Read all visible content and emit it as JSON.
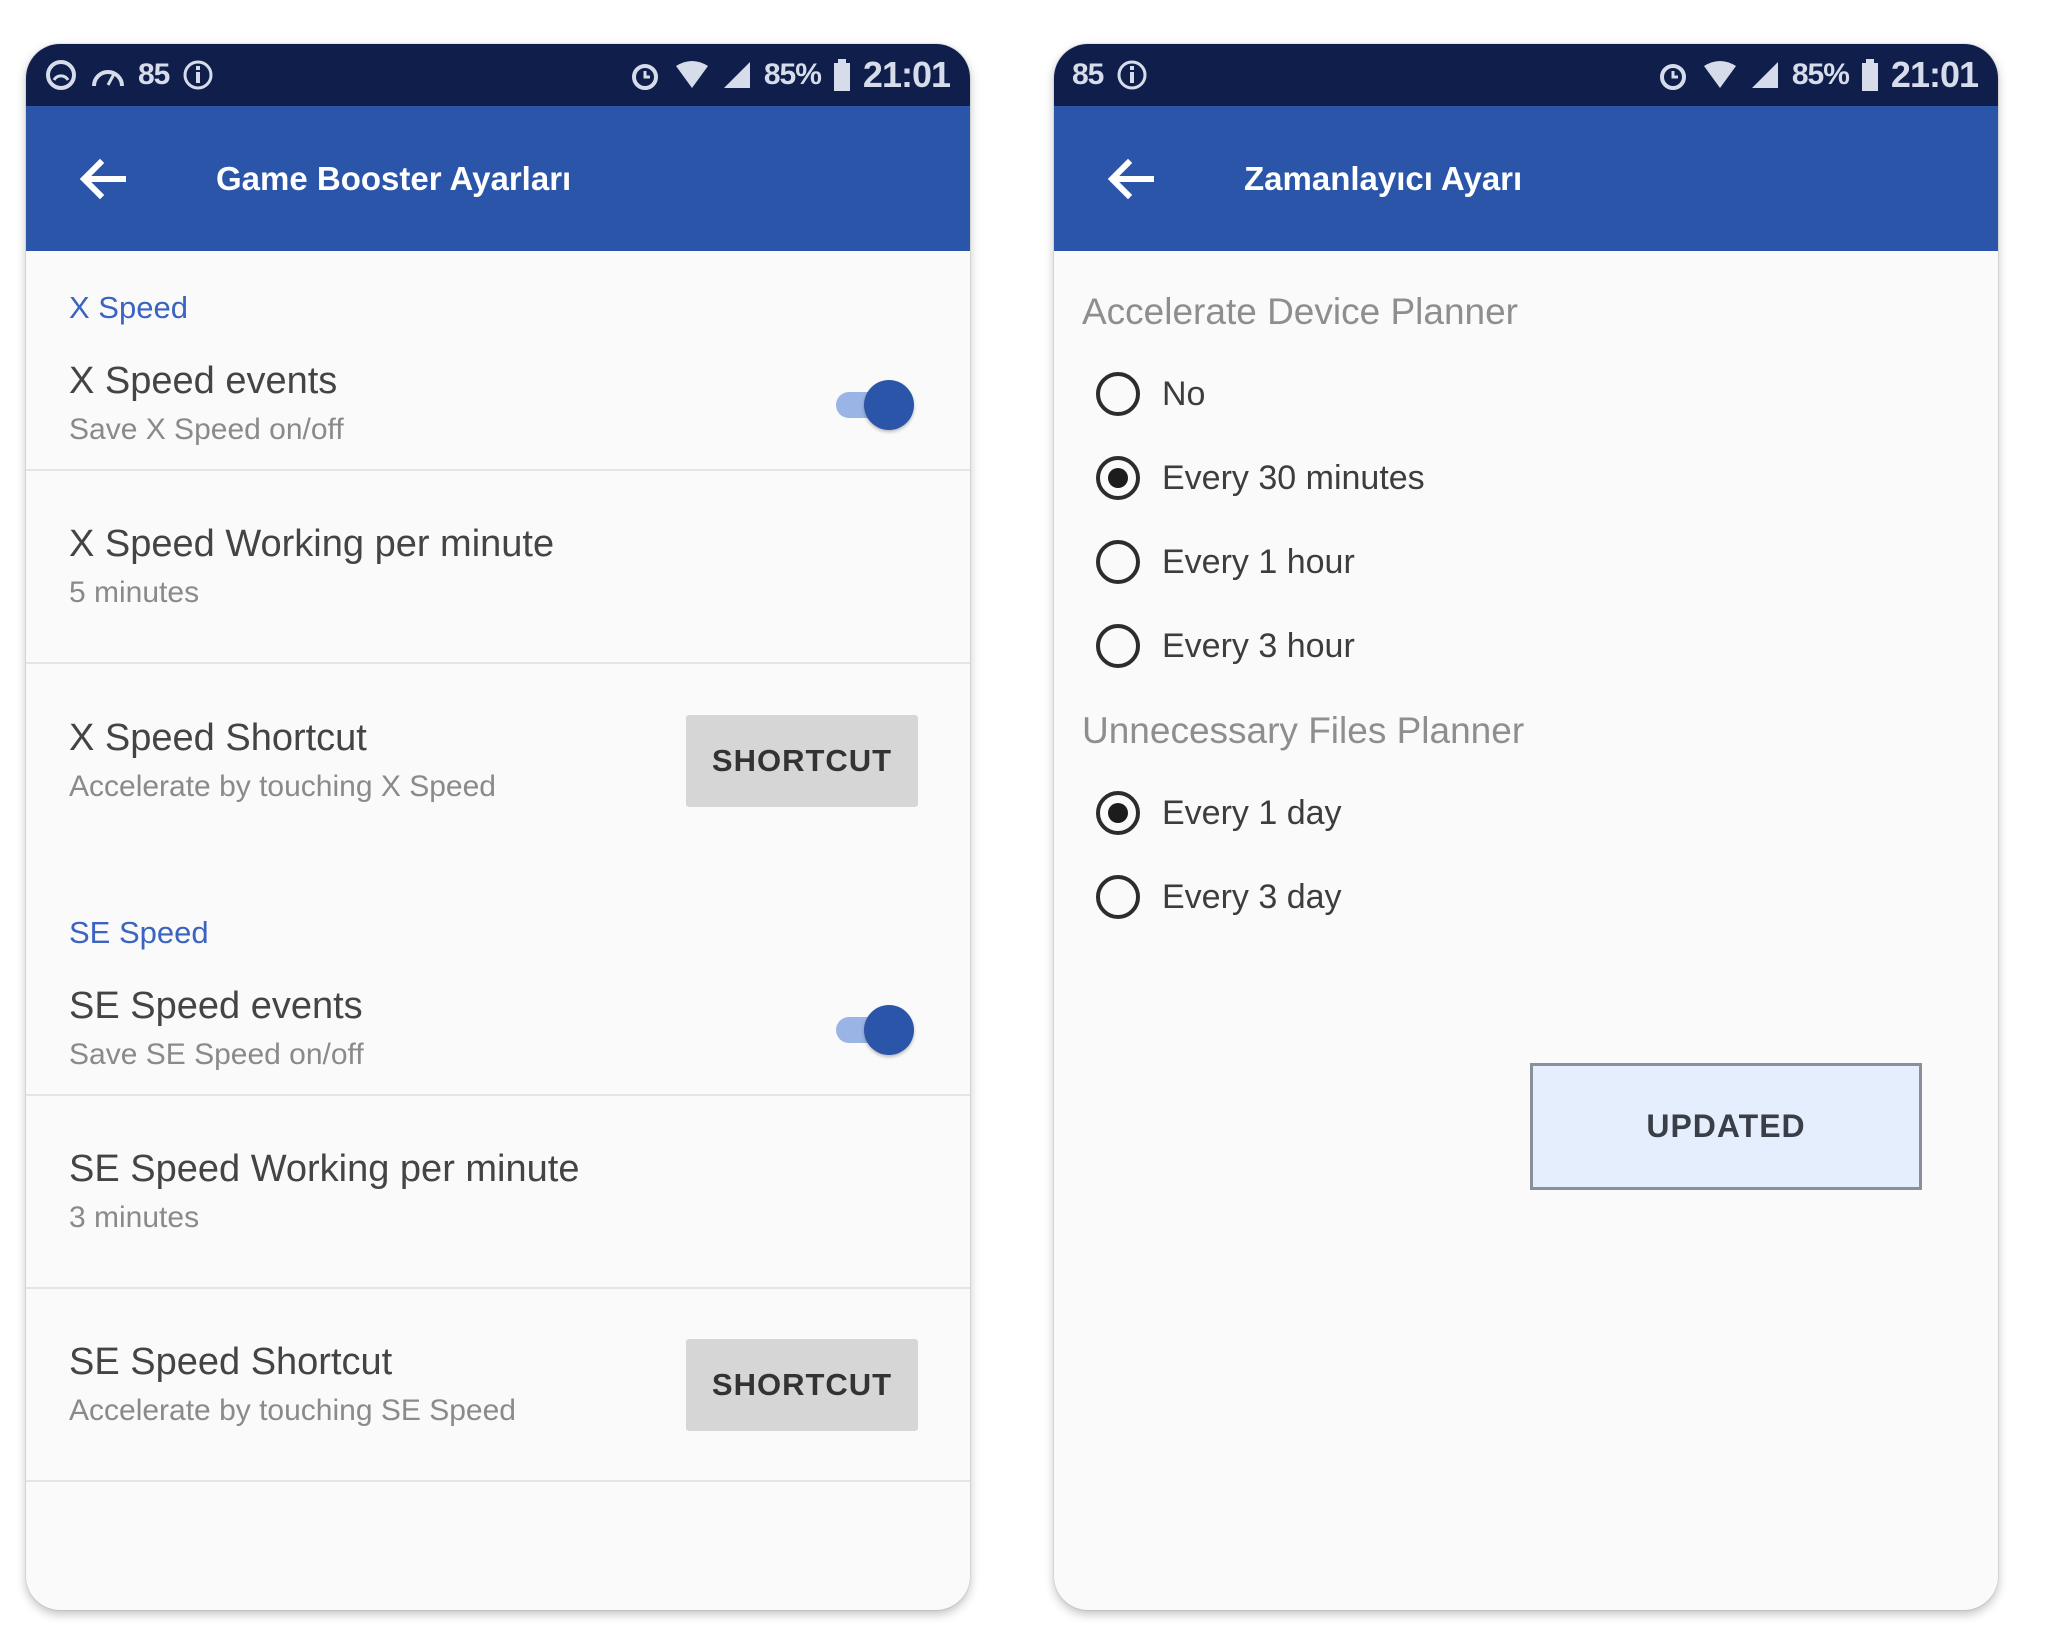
{
  "left": {
    "status_bar": {
      "left_num": "85",
      "battery_pct": "85%",
      "time": "21:01"
    },
    "app_bar": {
      "title": "Game Booster Ayarları"
    },
    "x_speed": {
      "header": "X Speed",
      "events": {
        "title": "X Speed events",
        "subtitle": "Save X Speed on/off",
        "enabled": true
      },
      "working": {
        "title": "X Speed Working per minute",
        "subtitle": "5 minutes"
      },
      "shortcut": {
        "title": "X Speed Shortcut",
        "subtitle": "Accelerate by touching X Speed",
        "button": "SHORTCUT"
      }
    },
    "se_speed": {
      "header": "SE Speed",
      "events": {
        "title": "SE Speed events",
        "subtitle": "Save SE Speed on/off",
        "enabled": true
      },
      "working": {
        "title": "SE Speed Working per minute",
        "subtitle": "3 minutes"
      },
      "shortcut": {
        "title": "SE Speed Shortcut",
        "subtitle": "Accelerate by touching SE Speed",
        "button": "SHORTCUT"
      }
    }
  },
  "right": {
    "status_bar": {
      "left_num": "85",
      "battery_pct": "85%",
      "time": "21:01"
    },
    "app_bar": {
      "title": "Zamanlayıcı Ayarı"
    },
    "device_planner": {
      "label": "Accelerate Device Planner",
      "options": [
        "No",
        "Every 30 minutes",
        "Every 1 hour",
        "Every 3 hour"
      ],
      "selected": "Every 30 minutes"
    },
    "files_planner": {
      "label": "Unnecessary Files Planner",
      "options": [
        "Every 1 day",
        "Every 3 day"
      ],
      "selected": "Every 1 day"
    },
    "updated_button": "UPDATED"
  },
  "colors": {
    "status_bar": "#0f1e4a",
    "app_bar": "#2a55a8",
    "accent": "#3a63c2",
    "toggle_thumb": "#2a55a8"
  },
  "icons": [
    "back-arrow-icon",
    "alarm-icon",
    "wifi-icon",
    "signal-icon",
    "battery-icon",
    "sync-icon",
    "info-icon"
  ]
}
